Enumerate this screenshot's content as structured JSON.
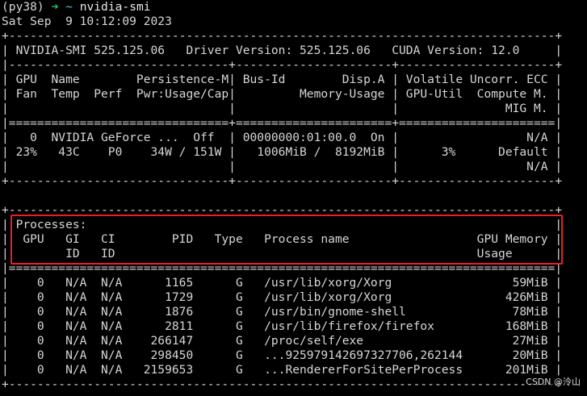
{
  "prompt": {
    "env": "(py38)",
    "arrow": "➜",
    "cwd": "~",
    "command": "nvidia-smi"
  },
  "timestamp": "Sat Sep  9 10:12:09 2023",
  "lines": {
    "l2": "+-----------------------------------------------------------------------------+",
    "l3": "| NVIDIA-SMI 525.125.06   Driver Version: 525.125.06   CUDA Version: 12.0     |",
    "l4": "|-------------------------------+----------------------+----------------------+",
    "l5": "| GPU  Name        Persistence-M| Bus-Id        Disp.A | Volatile Uncorr. ECC |",
    "l6": "| Fan  Temp  Perf  Pwr:Usage/Cap|         Memory-Usage | GPU-Util  Compute M. |",
    "l7": "|                               |                      |               MIG M. |",
    "l8": "|===============================+======================+======================|",
    "l9": "|   0  NVIDIA GeForce ...  Off  | 00000000:01:00.0  On |                  N/A |",
    "l10": "| 23%   43C    P0    34W / 151W |   1006MiB /  8192MiB |      3%      Default |",
    "l11": "|                               |                      |                  N/A |",
    "l12": "+-------------------------------+----------------------+----------------------+",
    "l13": "                                                                               ",
    "l14": "+-----------------------------------------------------------------------------+",
    "l15": "| Processes:                                                                  |",
    "l16": "|  GPU   GI   CI        PID   Type   Process name                  GPU Memory |",
    "l17": "|        ID   ID                                                   Usage      |",
    "l18": "|=============================================================================|",
    "l19": "|    0   N/A  N/A      1165      G   /usr/lib/xorg/Xorg                 59MiB |",
    "l20": "|    0   N/A  N/A      1729      G   /usr/lib/xorg/Xorg                426MiB |",
    "l21": "|    0   N/A  N/A      1876      G   /usr/bin/gnome-shell               78MiB |",
    "l22": "|    0   N/A  N/A      2811      G   /usr/lib/firefox/firefox          168MiB |",
    "l23": "|    0   N/A  N/A    266147      G   /proc/self/exe                     27MiB |",
    "l24": "|    0   N/A  N/A    298450      G   ...925979142697327706,262144       20MiB |",
    "l25": "|    0   N/A  N/A   2159653      G   ...RendererForSitePerProcess      201MiB |",
    "l26": "+-----------------------------------------------------------------------------+"
  },
  "watermark": "CSDN @泠山",
  "colors": {
    "background": "#000000",
    "text": "#d6d6d6",
    "prompt_arrow": "#22c55e",
    "prompt_cwd": "#3ec7d6",
    "highlight_box": "#e5202a"
  }
}
